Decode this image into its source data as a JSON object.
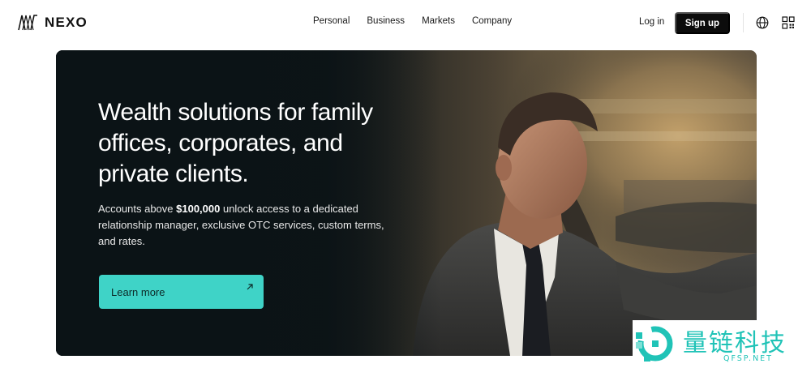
{
  "brand": {
    "name": "NEXO"
  },
  "nav": {
    "links": [
      "Personal",
      "Business",
      "Markets",
      "Company"
    ],
    "login_label": "Log in",
    "signup_label": "Sign up",
    "icons": [
      "globe-icon",
      "qr-code-icon"
    ]
  },
  "hero": {
    "title": "Wealth solutions for family offices, corporates, and private clients.",
    "desc_prefix": "Accounts above ",
    "desc_amount": "$100,000",
    "desc_suffix": " unlock access to a dedicated relationship manager, exclusive OTC services, custom terms, and rates.",
    "cta_label": "Learn more",
    "cta_icon": "arrow-up-right-icon",
    "image": "man-in-suit-driving-car-photo"
  },
  "colors": {
    "accent": "#3fd3c7",
    "signup_bg": "#0c0c0c",
    "hero_dark": "#0b1316"
  },
  "watermark": {
    "cn_text": "量链科技",
    "en_text": "QFSP.NET"
  }
}
